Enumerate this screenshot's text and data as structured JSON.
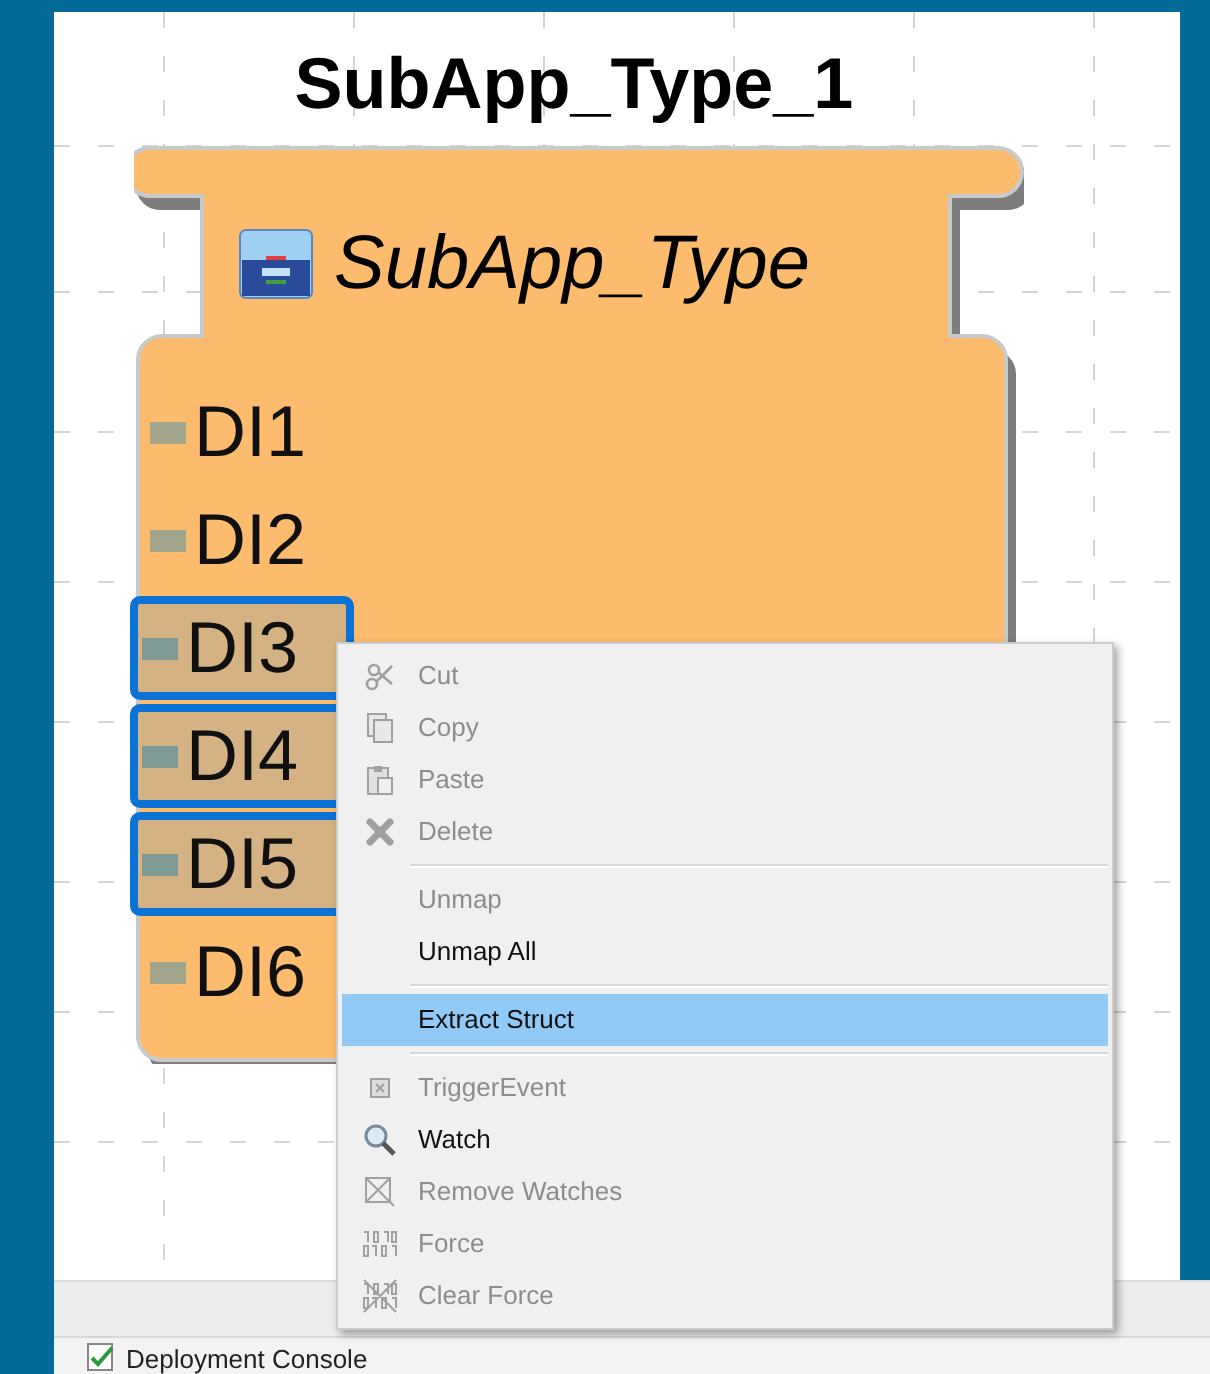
{
  "block": {
    "instance_name": "SubApp_Type_1",
    "type_name": "SubApp_Type",
    "pins": [
      {
        "label": "DI1",
        "selected": false
      },
      {
        "label": "DI2",
        "selected": false
      },
      {
        "label": "DI3",
        "selected": true
      },
      {
        "label": "DI4",
        "selected": true
      },
      {
        "label": "DI5",
        "selected": true
      },
      {
        "label": "DI6",
        "selected": false
      }
    ]
  },
  "context_menu": {
    "items": [
      {
        "kind": "item",
        "label": "Cut",
        "disabled": true,
        "selected": false
      },
      {
        "kind": "item",
        "label": "Copy",
        "disabled": true,
        "selected": false
      },
      {
        "kind": "item",
        "label": "Paste",
        "disabled": true,
        "selected": false
      },
      {
        "kind": "item",
        "label": "Delete",
        "disabled": true,
        "selected": false
      },
      {
        "kind": "separator"
      },
      {
        "kind": "item",
        "label": "Unmap",
        "disabled": true,
        "selected": false
      },
      {
        "kind": "item",
        "label": "Unmap All",
        "disabled": false,
        "selected": false
      },
      {
        "kind": "separator"
      },
      {
        "kind": "item",
        "label": "Extract Struct",
        "disabled": false,
        "selected": true
      },
      {
        "kind": "separator"
      },
      {
        "kind": "item",
        "label": "TriggerEvent",
        "disabled": true,
        "selected": false
      },
      {
        "kind": "item",
        "label": "Watch",
        "disabled": false,
        "selected": false
      },
      {
        "kind": "item",
        "label": "Remove Watches",
        "disabled": true,
        "selected": false
      },
      {
        "kind": "item",
        "label": "Force",
        "disabled": true,
        "selected": false
      },
      {
        "kind": "item",
        "label": "Clear Force",
        "disabled": true,
        "selected": false
      }
    ]
  },
  "status_bar": {
    "tab": "Deployment Console"
  }
}
